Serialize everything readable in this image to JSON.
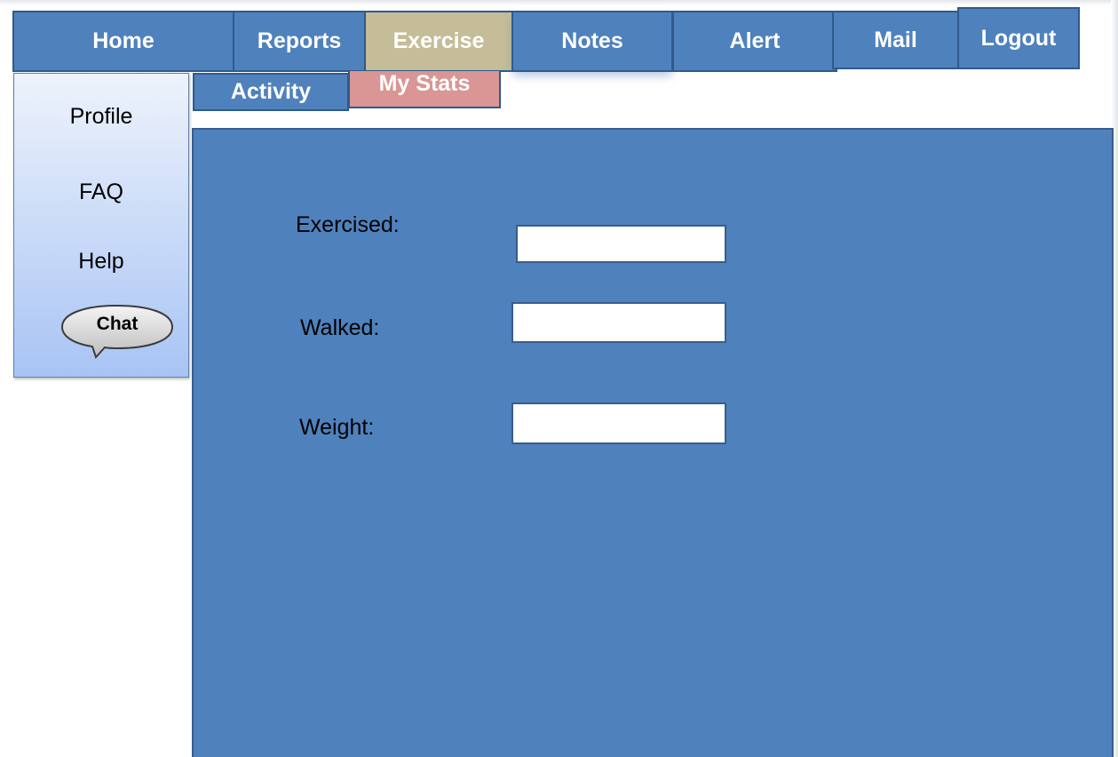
{
  "nav": {
    "tabs": [
      {
        "label": "Home"
      },
      {
        "label": "Reports"
      },
      {
        "label": "Exercise"
      },
      {
        "label": "Notes"
      },
      {
        "label": "Alert"
      },
      {
        "label": "Mail"
      },
      {
        "label": "Logout"
      }
    ],
    "active_tab": "Exercise"
  },
  "subnav": {
    "tabs": [
      {
        "label": "Activity"
      },
      {
        "label": "My Stats"
      }
    ],
    "active_tab": "My Stats"
  },
  "sidebar": {
    "items": [
      {
        "label": "Profile"
      },
      {
        "label": "FAQ"
      },
      {
        "label": "Help"
      }
    ],
    "chat_label": "Chat"
  },
  "form": {
    "fields": [
      {
        "label": "Exercised:",
        "value": ""
      },
      {
        "label": "Walked:",
        "value": ""
      },
      {
        "label": "Weight:",
        "value": ""
      }
    ]
  },
  "colors": {
    "tab_blue": "#4f81bd",
    "tab_border": "#2f5a8c",
    "active_tab": "#c4bd97",
    "active_subtab": "#d99694",
    "sidebar_top": "#eef3fc",
    "sidebar_bottom": "#a8c4f4"
  }
}
